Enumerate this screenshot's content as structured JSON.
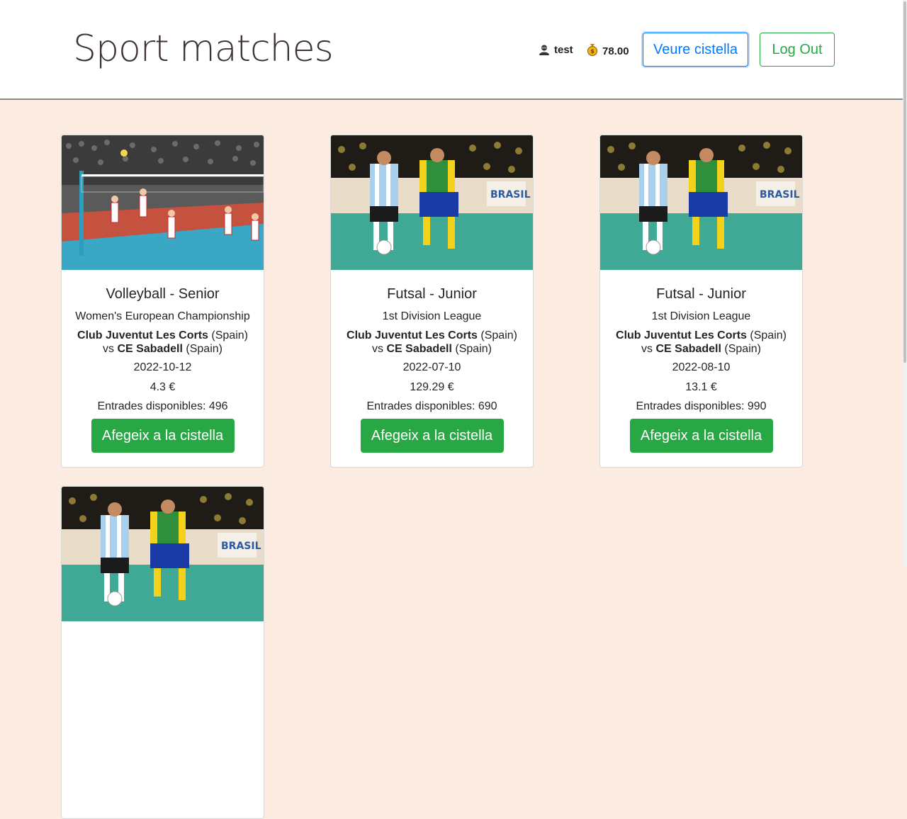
{
  "header": {
    "title": "Sport matches",
    "username": "test",
    "balance": "78.00",
    "cart_button": "Veure cistella",
    "logout_button": "Log Out"
  },
  "cards": [
    {
      "sport": "Volleyball - Senior",
      "competition": "Women's European Championship",
      "home_team": "Club Juventut Les Corts",
      "home_country": "(Spain)",
      "vs": "vs",
      "away_team": "CE Sabadell",
      "away_country": "(Spain)",
      "date": "2022-10-12",
      "price": "4.3 €",
      "stock": "Entrades disponibles: 496",
      "add_button": "Afegeix a la cistella",
      "image": "volleyball-photo"
    },
    {
      "sport": "Futsal - Junior",
      "competition": "1st Division League",
      "home_team": "Club Juventut Les Corts",
      "home_country": "(Spain)",
      "vs": "vs",
      "away_team": "CE Sabadell",
      "away_country": "(Spain)",
      "date": "2022-07-10",
      "price": "129.29 €",
      "stock": "Entrades disponibles: 690",
      "add_button": "Afegeix a la cistella",
      "image": "futsal-photo"
    },
    {
      "sport": "Futsal - Junior",
      "competition": "1st Division League",
      "home_team": "Club Juventut Les Corts",
      "home_country": "(Spain)",
      "vs": "vs",
      "away_team": "CE Sabadell",
      "away_country": "(Spain)",
      "date": "2022-08-10",
      "price": "13.1 €",
      "stock": "Entrades disponibles: 990",
      "add_button": "Afegeix a la cistella",
      "image": "futsal-photo"
    },
    {
      "image": "futsal-photo"
    }
  ],
  "colors": {
    "page_background": "#fbebe0",
    "primary": "#007bff",
    "success": "#28a745",
    "title": "#3d3236"
  }
}
